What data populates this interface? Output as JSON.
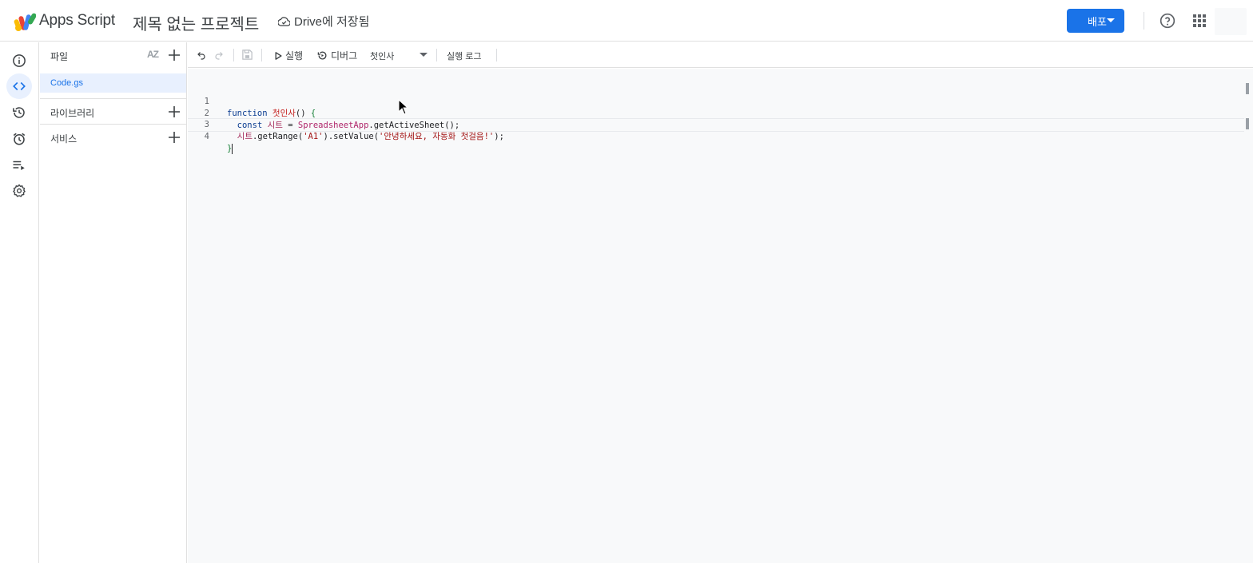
{
  "header": {
    "app_name": "Apps Script",
    "project_title": "제목 없는 프로젝트",
    "drive_status": "Drive에 저장됨",
    "deploy_label": "배포",
    "accent_color": "#1a73e8"
  },
  "rail": {
    "items": [
      {
        "icon": "info-icon",
        "label": "개요"
      },
      {
        "icon": "code-icon",
        "label": "편집기",
        "active": true
      },
      {
        "icon": "history-icon",
        "label": "프로젝트 기록"
      },
      {
        "icon": "alarm-icon",
        "label": "트리거"
      },
      {
        "icon": "executions-icon",
        "label": "실행"
      },
      {
        "icon": "gear-icon",
        "label": "프로젝트 설정"
      }
    ]
  },
  "files_panel": {
    "title": "파일",
    "files": [
      "Code.gs"
    ],
    "libraries_label": "라이브러리",
    "services_label": "서비스"
  },
  "toolbar": {
    "run_label": "실행",
    "debug_label": "디버그",
    "function_selected": "첫인사",
    "execution_log_label": "실행 로그"
  },
  "editor": {
    "line_numbers": [
      "1",
      "2",
      "3",
      "4"
    ],
    "lines": [
      "function 첫인사() {",
      "  const 시트 = SpreadsheetApp.getActiveSheet();",
      "  시트.getRange('A1').setValue('안녕하세요, 자동화 첫걸음!');",
      "}"
    ],
    "tokens": {
      "l1_kw": "function",
      "l1_fn": "첫인사",
      "l1_rest": "() ",
      "l1_brace": "{",
      "l2_kw": "const",
      "l2_var": "시트",
      "l2_eq": " = ",
      "l2_cls": "SpreadsheetApp",
      "l2_rest": ".getActiveSheet",
      "l2_paren": "();",
      "l3_var": "시트",
      "l3_a": ".getRange(",
      "l3_s1": "'A1'",
      "l3_b": ").setValue(",
      "l3_s2": "'안녕하세요, 자동화 첫걸음!'",
      "l3_c": ");",
      "l4_brace": "}"
    }
  }
}
